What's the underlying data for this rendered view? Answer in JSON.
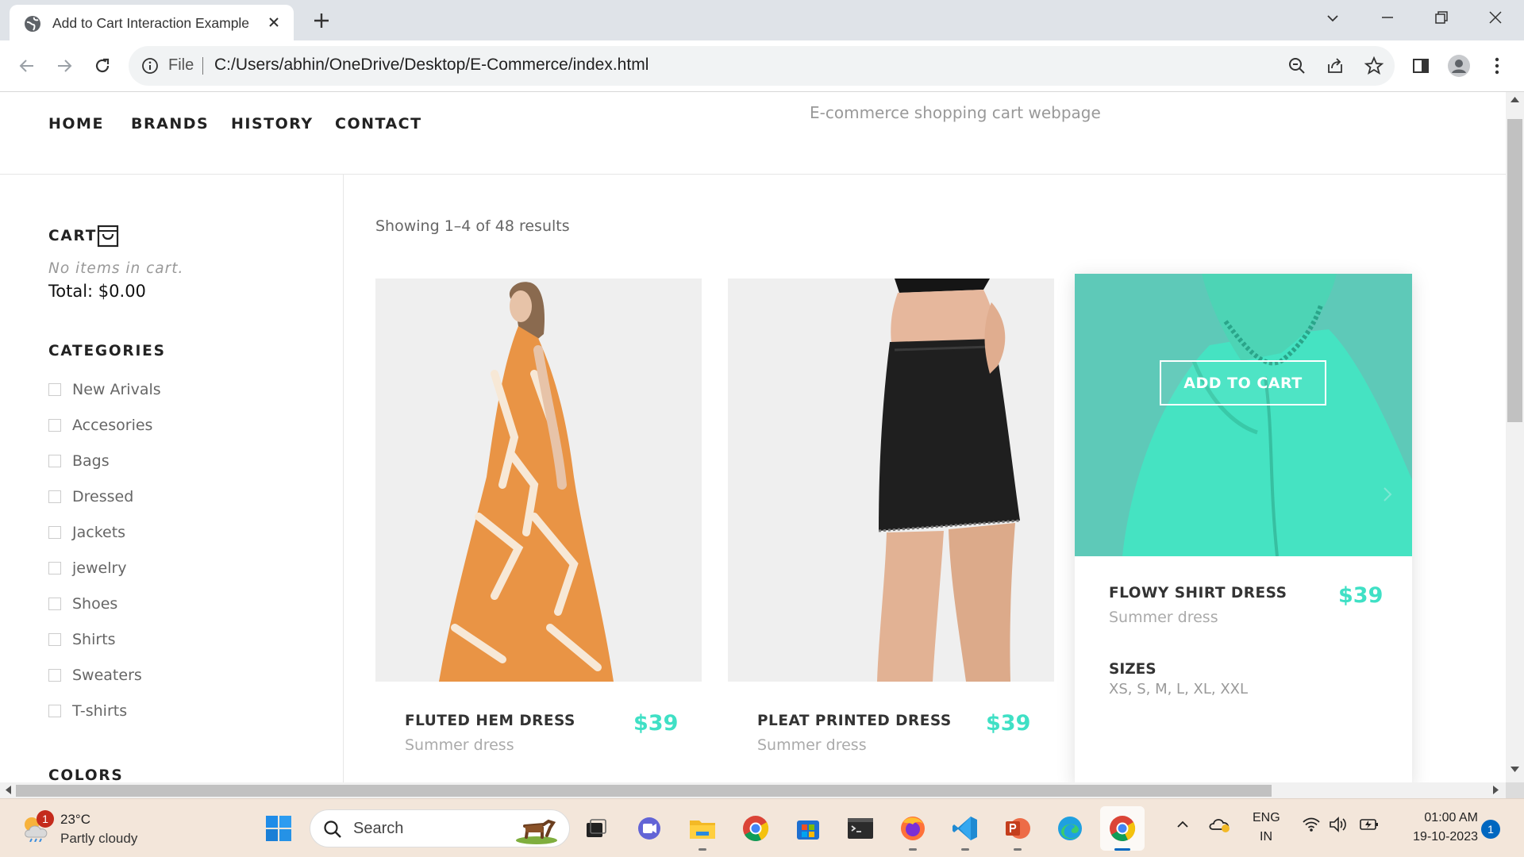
{
  "browser": {
    "tab_title": "Add to Cart Interaction Example",
    "omnibox_scheme": "File",
    "url": "C:/Users/abhin/OneDrive/Desktop/E-Commerce/index.html"
  },
  "nav": {
    "links": [
      "HOME",
      "BRANDS",
      "HISTORY",
      "CONTACT"
    ],
    "subtitle": "E-commerce shopping cart webpage"
  },
  "sidebar": {
    "cart_heading": "CART",
    "cart_empty": "No items in cart.",
    "cart_total": "Total: $0.00",
    "categories_heading": "CATEGORIES",
    "categories": [
      "New Arivals",
      "Accesories",
      "Bags",
      "Dressed",
      "Jackets",
      "jewelry",
      "Shoes",
      "Shirts",
      "Sweaters",
      "T-shirts"
    ],
    "colors_heading": "COLORS"
  },
  "main": {
    "results_text": "Showing 1–4 of 48 results",
    "products": [
      {
        "name": "FLUTED HEM DRESS",
        "subtitle": "Summer dress",
        "price": "$39"
      },
      {
        "name": "PLEAT PRINTED DRESS",
        "subtitle": "Summer dress",
        "price": "$39"
      },
      {
        "name": "FLOWY SHIRT DRESS",
        "subtitle": "Summer dress",
        "price": "$39",
        "button": "ADD TO CART",
        "sizes_title": "SIZES",
        "sizes": "XS, S, M, L, XL, XXL"
      }
    ],
    "accent_color": "#3fe0c5"
  },
  "taskbar": {
    "weather_temp": "23°C",
    "weather_desc": "Partly cloudy",
    "weather_badge": "1",
    "search_label": "Search",
    "lang_top": "ENG",
    "lang_bottom": "IN",
    "time": "01:00 AM",
    "date": "19-10-2023",
    "notification_count": "1"
  }
}
